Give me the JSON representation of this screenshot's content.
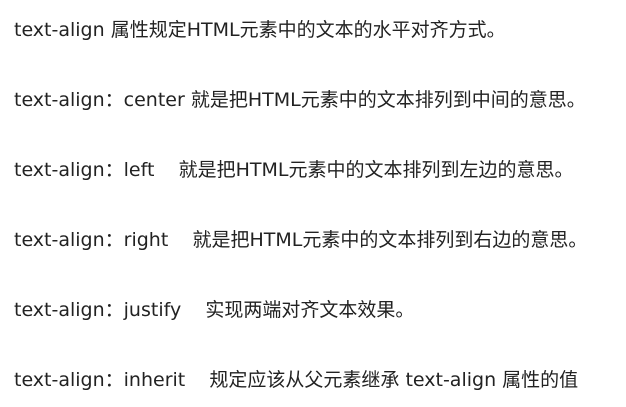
{
  "document": {
    "lines": [
      "text-align 属性规定HTML元素中的文本的水平对齐方式。",
      "text-align：center 就是把HTML元素中的文本排列到中间的意思。",
      "text-align：left    就是把HTML元素中的文本排列到左边的意思。",
      "text-align：right    就是把HTML元素中的文本排列到右边的意思。",
      "text-align：justify    实现两端对齐文本效果。",
      "text-align：inherit    规定应该从父元素继承 text-align 属性的值"
    ]
  }
}
